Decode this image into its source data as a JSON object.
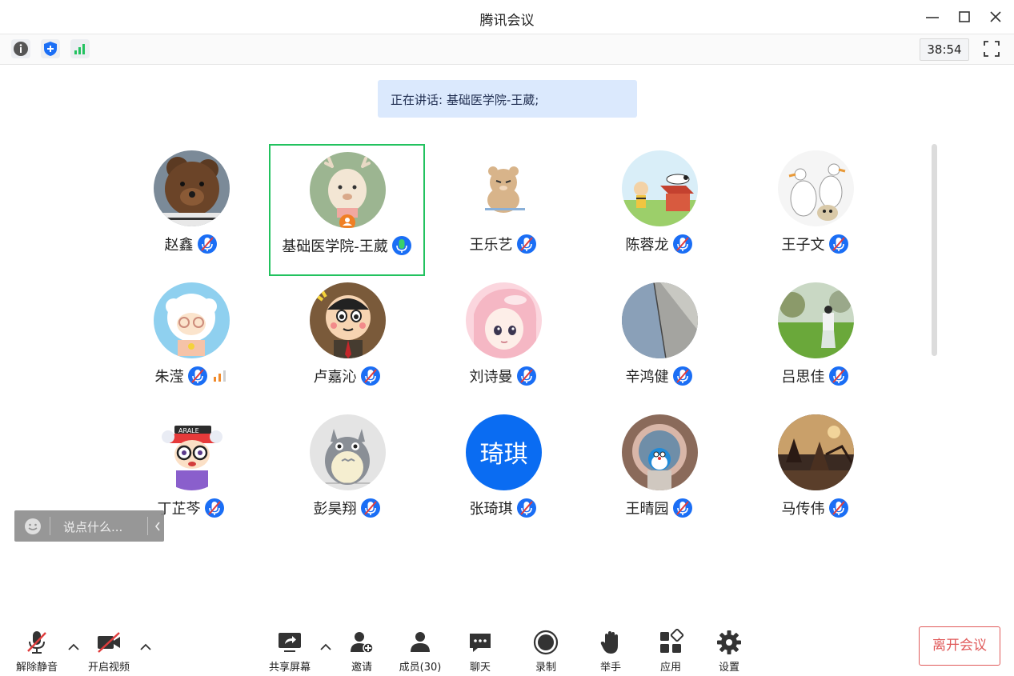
{
  "window": {
    "title": "腾讯会议"
  },
  "topbar": {
    "timer": "38:54"
  },
  "speaking": {
    "text": "正在讲话: 基础医学院-王葳;"
  },
  "participants": [
    {
      "name": "赵鑫",
      "avatar": "brown-teddy-bear"
    },
    {
      "name": "基础医学院-王葳",
      "avatar": "cartoon-deer",
      "speaking": true
    },
    {
      "name": "王乐艺",
      "avatar": "sleepy-bear-sticker"
    },
    {
      "name": "陈蓉龙",
      "avatar": "snoopy-doghouse"
    },
    {
      "name": "王子文",
      "avatar": "two-geese"
    },
    {
      "name": "朱滢",
      "avatar": "cartoon-sheep",
      "signal": true
    },
    {
      "name": "卢嘉沁",
      "avatar": "crayon-shinchan"
    },
    {
      "name": "刘诗曼",
      "avatar": "anime-girl-pink-hair"
    },
    {
      "name": "辛鸿健",
      "avatar": "architecture-photo"
    },
    {
      "name": "吕思佳",
      "avatar": "park-photo"
    },
    {
      "name": "丁芷芩",
      "avatar": "arale-cartoon"
    },
    {
      "name": "彭昊翔",
      "avatar": "totoro"
    },
    {
      "name": "张琦琪",
      "avatar": "text-avatar",
      "avatar_text": "琦琪"
    },
    {
      "name": "王晴园",
      "avatar": "doraemon-window"
    },
    {
      "name": "马传伟",
      "avatar": "sunset-scene"
    }
  ],
  "chat": {
    "placeholder": "说点什么..."
  },
  "bottombar": {
    "unmute": "解除静音",
    "start_video": "开启视频",
    "share_screen": "共享屏幕",
    "invite": "邀请",
    "members": "成员(30)",
    "chat": "聊天",
    "record": "录制",
    "raise_hand": "举手",
    "apps": "应用",
    "settings": "设置",
    "leave": "离开会议"
  },
  "colors": {
    "accent": "#1a6ef5",
    "speaking_green": "#22c25f",
    "leave_red": "#e05a5a",
    "avatar_blue": "#0a6cf2"
  }
}
